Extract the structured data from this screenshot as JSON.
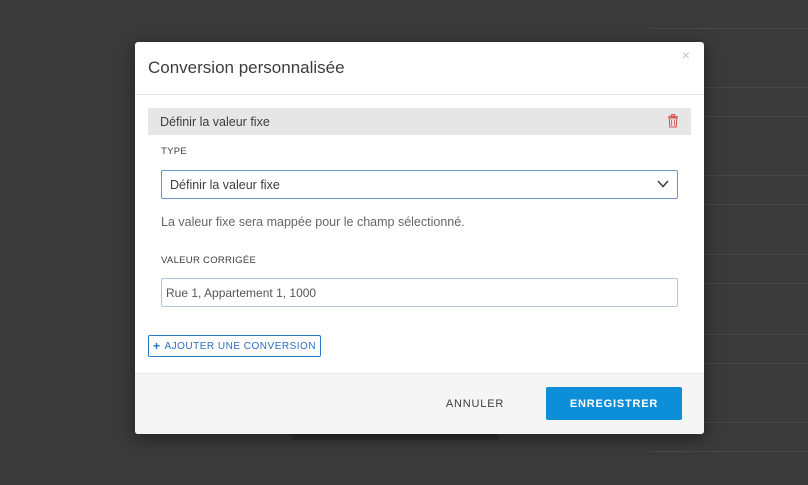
{
  "modal": {
    "title": "Conversion personnalisée",
    "close_glyph": "×"
  },
  "section": {
    "title": "Définir la valeur fixe",
    "delete_icon": "trash-icon",
    "delete_icon_color": "#d9534f"
  },
  "type_field": {
    "label": "TYPE",
    "selected_value": "Définir la valeur fixe"
  },
  "help_text": "La valeur fixe sera mappée pour le champ sélectionné.",
  "corrected_value_field": {
    "label": "VALEUR CORRIGÉE",
    "value": "Rue 1, Appartement 1, 1000"
  },
  "add_conversion": {
    "label": "AJOUTER UNE CONVERSION",
    "icon": "plus-icon"
  },
  "footer": {
    "cancel_label": "ANNULER",
    "save_label": "ENREGISTRER"
  },
  "colors": {
    "accent": "#0c8fd8",
    "link": "#2a6fbf",
    "overlay": "#3a3a3a"
  }
}
